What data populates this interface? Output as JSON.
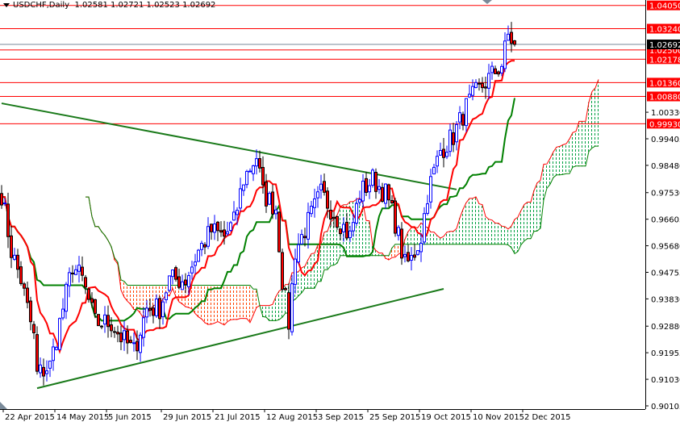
{
  "header": {
    "symbol": "USDCHF,Daily",
    "ohlc": "1.02581 1.02721 1.02523 1.02692"
  },
  "chart_data": {
    "type": "candlestick",
    "title": "USDCHF,Daily",
    "ylim": [
      0.90105,
      1.0405
    ],
    "y_ticks": [
      "1.00330",
      "0.99405",
      "0.98480",
      "0.97530",
      "0.96605",
      "0.95680",
      "0.94755",
      "0.93830",
      "0.92880",
      "0.91955",
      "0.91030",
      "0.90105"
    ],
    "x_ticks": [
      {
        "label": "22 Apr 2015",
        "bar": 5
      },
      {
        "label": "14 May 2015",
        "bar": 21
      },
      {
        "label": "5 Jun 2015",
        "bar": 37
      },
      {
        "label": "29 Jun 2015",
        "bar": 54
      },
      {
        "label": "21 Jul 2015",
        "bar": 70
      },
      {
        "label": "12 Aug 2015",
        "bar": 86
      },
      {
        "label": "3 Sep 2015",
        "bar": 102
      },
      {
        "label": "25 Sep 2015",
        "bar": 118
      },
      {
        "label": "19 Oct 2015",
        "bar": 134
      },
      {
        "label": "10 Nov 2015",
        "bar": 150
      },
      {
        "label": "2 Dec 2015",
        "bar": 166
      }
    ],
    "bars": 160,
    "approx_close_path": [
      [
        0,
        0.975
      ],
      [
        3,
        0.955
      ],
      [
        6,
        0.945
      ],
      [
        10,
        0.925
      ],
      [
        11,
        0.912
      ],
      [
        15,
        0.915
      ],
      [
        19,
        0.935
      ],
      [
        22,
        0.95
      ],
      [
        25,
        0.945
      ],
      [
        29,
        0.93
      ],
      [
        34,
        0.93
      ],
      [
        37,
        0.925
      ],
      [
        41,
        0.92
      ],
      [
        45,
        0.935
      ],
      [
        49,
        0.935
      ],
      [
        52,
        0.945
      ],
      [
        57,
        0.945
      ],
      [
        61,
        0.955
      ],
      [
        65,
        0.962
      ],
      [
        69,
        0.96
      ],
      [
        72,
        0.965
      ],
      [
        75,
        0.98
      ],
      [
        79,
        0.988
      ],
      [
        81,
        0.975
      ],
      [
        85,
        0.97
      ],
      [
        87,
        0.945
      ],
      [
        89,
        0.93
      ],
      [
        91,
        0.955
      ],
      [
        95,
        0.965
      ],
      [
        99,
        0.975
      ],
      [
        102,
        0.97
      ],
      [
        105,
        0.965
      ],
      [
        108,
        0.96
      ],
      [
        111,
        0.975
      ],
      [
        115,
        0.98
      ],
      [
        119,
        0.975
      ],
      [
        122,
        0.965
      ],
      [
        125,
        0.95
      ],
      [
        127,
        0.952
      ],
      [
        130,
        0.96
      ],
      [
        132,
        0.975
      ],
      [
        136,
        0.99
      ],
      [
        140,
        0.995
      ],
      [
        144,
        1.005
      ],
      [
        147,
        1.01
      ],
      [
        151,
        1.015
      ],
      [
        155,
        1.02
      ],
      [
        157,
        1.03
      ],
      [
        159,
        1.02692
      ]
    ],
    "indicators": [
      "Ichimoku Tenkan-sen (9)",
      "Kijun-sen (26)",
      "Senkou Span A/B cloud (shift 26)"
    ],
    "trendlines": [
      {
        "name": "upper-trendline",
        "from": [
          0,
          1.0064
        ],
        "to": [
          141,
          0.9764
        ],
        "color": "#1a7a1a"
      },
      {
        "name": "lower-trendline",
        "from": [
          11,
          0.9072
        ],
        "to": [
          137,
          0.9418
        ],
        "color": "#1a7a1a"
      }
    ],
    "levels": [
      {
        "value": "1.04050",
        "price": 1.0405
      },
      {
        "value": "1.03240",
        "price": 1.0324
      },
      {
        "value": "1.02500",
        "price": 1.025
      },
      {
        "value": "1.02178",
        "price": 1.02178
      },
      {
        "value": "1.01360",
        "price": 1.0136
      },
      {
        "value": "1.00880",
        "price": 1.0088
      },
      {
        "value": "0.99930",
        "price": 0.9993
      }
    ],
    "current_price": {
      "value": "1.02692",
      "price": 1.02692
    },
    "colors": {
      "level": "#ff0000",
      "bull": "#0000ff",
      "bear": "#ff0000",
      "tenkan": "#ff0000",
      "kijun": "#008000",
      "cloud_up": "#00a040",
      "cloud_down": "#ff4000",
      "current": "#7a8a99"
    }
  }
}
